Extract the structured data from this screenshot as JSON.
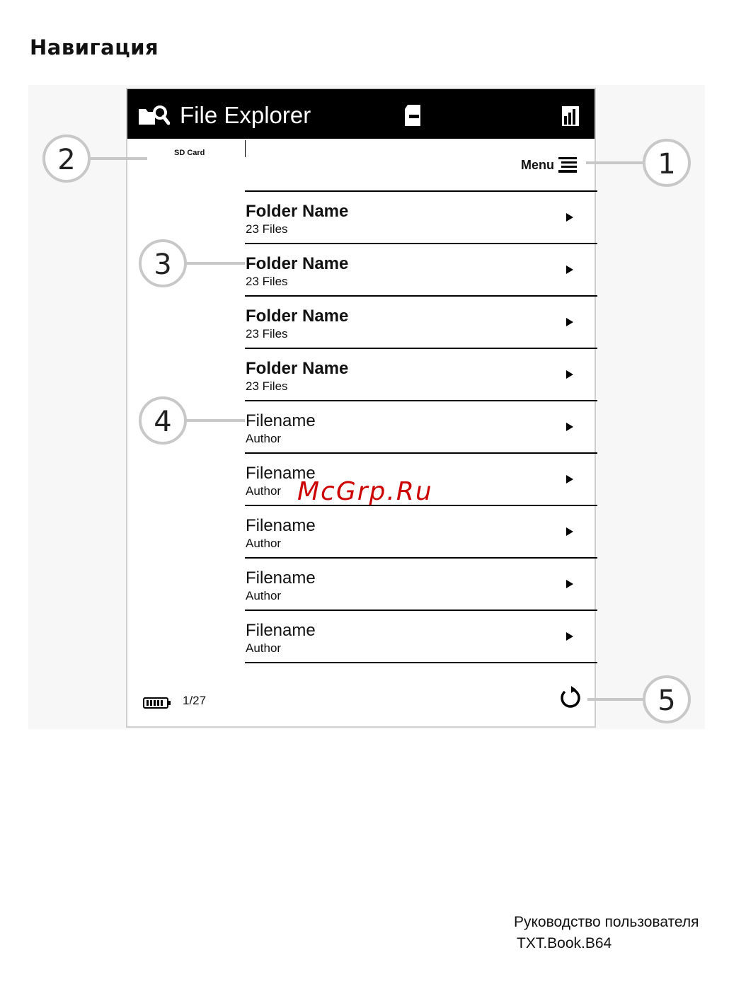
{
  "page": {
    "heading": "Навигация"
  },
  "device": {
    "app_title": "File Explorer",
    "location_label": "SD Card",
    "menu_label": "Menu",
    "items": [
      {
        "kind": "folder",
        "title": "Folder Name",
        "subtitle": "23 Files"
      },
      {
        "kind": "folder",
        "title": "Folder Name",
        "subtitle": "23 Files"
      },
      {
        "kind": "folder",
        "title": "Folder Name",
        "subtitle": "23 Files"
      },
      {
        "kind": "folder",
        "title": "Folder Name",
        "subtitle": "23 Files"
      },
      {
        "kind": "file",
        "title": "Filename",
        "subtitle": "Author"
      },
      {
        "kind": "file",
        "title": "Filename",
        "subtitle": "Author"
      },
      {
        "kind": "file",
        "title": "Filename",
        "subtitle": "Author"
      },
      {
        "kind": "file",
        "title": "Filename",
        "subtitle": "Author"
      },
      {
        "kind": "file",
        "title": "Filename",
        "subtitle": "Author"
      }
    ],
    "page_counter": "1/27",
    "icons": {
      "app": "folder-search-icon",
      "sd": "sd-card-icon",
      "signal": "signal-icon",
      "menu": "menu-icon",
      "row": "chevron-right-icon",
      "battery": "battery-icon",
      "refresh": "refresh-icon"
    }
  },
  "callouts": [
    "1",
    "2",
    "3",
    "4",
    "5"
  ],
  "footer": {
    "line1": "Руководство пользователя",
    "line2": "TXT.Book.B64"
  },
  "watermark": "McGrp.Ru"
}
